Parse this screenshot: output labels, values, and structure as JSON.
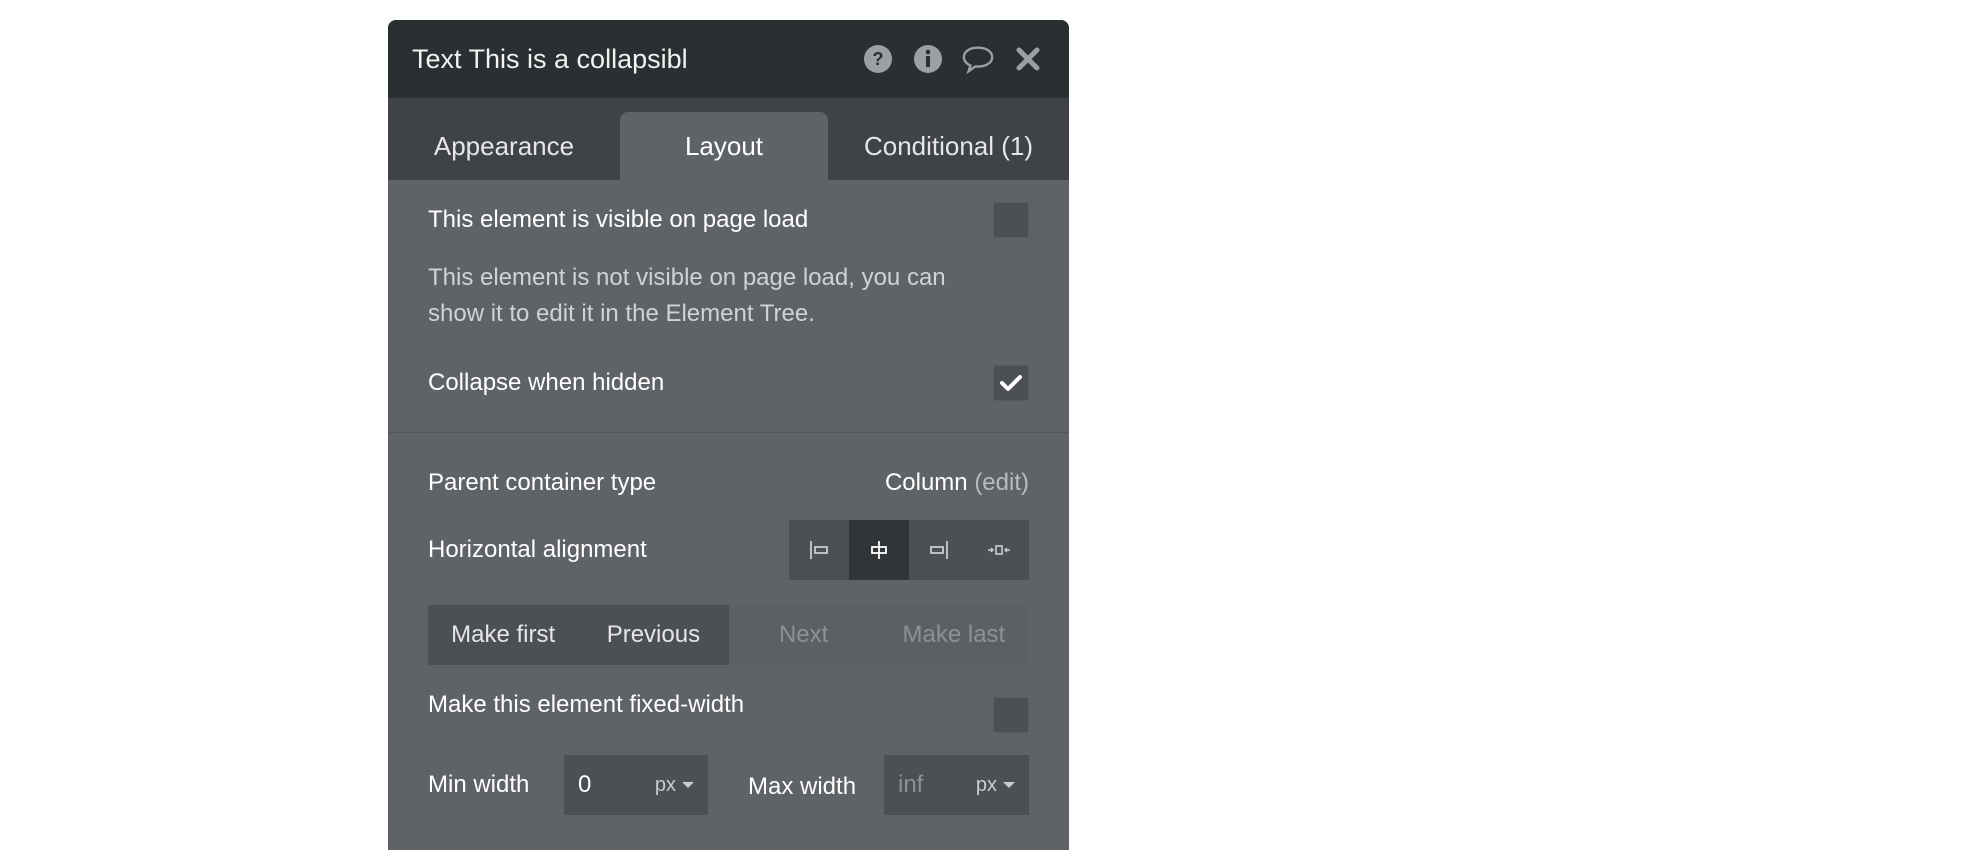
{
  "panel": {
    "title": "Text This is a collapsibl",
    "icons": [
      "help-icon",
      "info-icon",
      "comment-icon",
      "close-icon"
    ]
  },
  "tabs": [
    {
      "label": "Appearance"
    },
    {
      "label": "Layout"
    },
    {
      "label": "Conditional (1)"
    }
  ],
  "visibility": {
    "visible_label": "This element is visible on page load",
    "visible_checked": false,
    "note": "This element is not visible on page load, you can show it to edit it in the Element Tree.",
    "collapse_label": "Collapse when hidden",
    "collapse_checked": true
  },
  "layout": {
    "parent_label": "Parent container type",
    "parent_value": "Column",
    "parent_edit": "(edit)",
    "halign_label": "Horizontal alignment",
    "halign_options": [
      "align-left-icon",
      "align-center-icon",
      "align-right-icon",
      "align-spread-icon"
    ],
    "halign_active": "align-center-icon",
    "order_buttons": [
      {
        "label": "Make first"
      },
      {
        "label": "Previous"
      },
      {
        "label": "Next"
      },
      {
        "label": "Make last"
      }
    ],
    "fixed_width_label": "Make this element fixed-width",
    "fixed_width_checked": false,
    "min_width_label": "Min width",
    "min_width_value": "0",
    "min_width_unit": "px",
    "max_width_label": "Max width",
    "max_width_placeholder": "inf",
    "max_width_unit": "px"
  },
  "colors": {
    "titlebar": "#2a2f31",
    "tabs": "#3f4347",
    "panel": "#5f6367",
    "control": "#4c5054",
    "active_control": "#323538"
  }
}
